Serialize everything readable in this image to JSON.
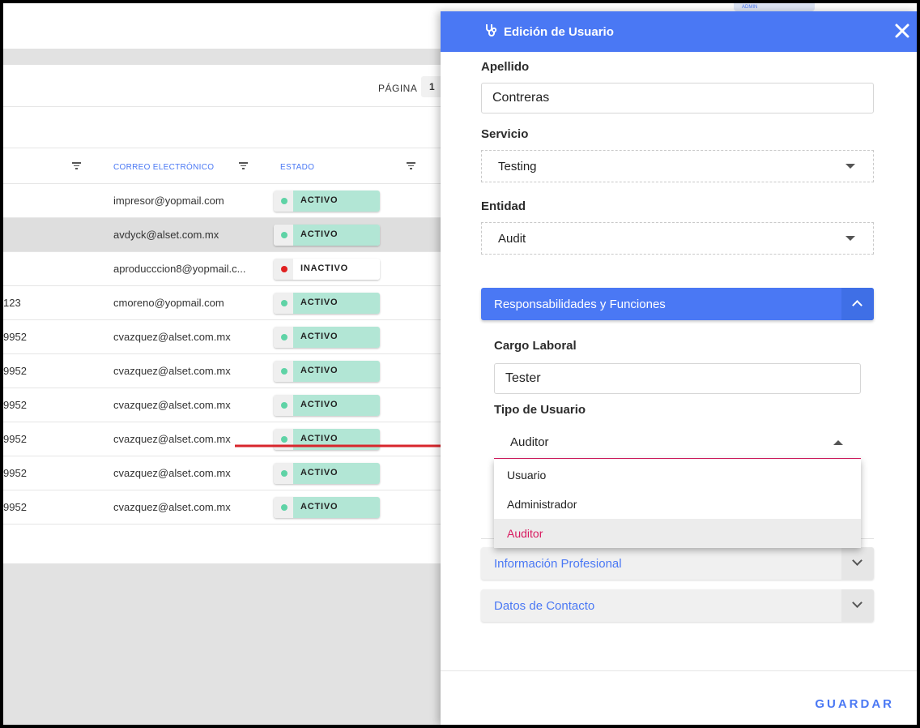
{
  "header": {
    "admin_badge": "ADMIN"
  },
  "pagination": {
    "label": "PÁGINA",
    "page": "1"
  },
  "table": {
    "columns": [
      "CORREO ELECTRÓNICO",
      "ESTADO"
    ],
    "rows": [
      {
        "id": "",
        "email": "impresor@yopmail.com",
        "status": "ACTIVO"
      },
      {
        "id": "",
        "email": "avdyck@alset.com.mx",
        "status": "ACTIVO"
      },
      {
        "id": "",
        "email": "aproducccion8@yopmail.c...",
        "status": "INACTIVO"
      },
      {
        "id": "123",
        "email": "cmoreno@yopmail.com",
        "status": "ACTIVO"
      },
      {
        "id": "9952",
        "email": "cvazquez@alset.com.mx",
        "status": "ACTIVO"
      },
      {
        "id": "9952",
        "email": "cvazquez@alset.com.mx",
        "status": "ACTIVO"
      },
      {
        "id": "9952",
        "email": "cvazquez@alset.com.mx",
        "status": "ACTIVO"
      },
      {
        "id": "9952",
        "email": "cvazquez@alset.com.mx",
        "status": "ACTIVO"
      },
      {
        "id": "9952",
        "email": "cvazquez@alset.com.mx",
        "status": "ACTIVO"
      },
      {
        "id": "9952",
        "email": "cvazquez@alset.com.mx",
        "status": "ACTIVO"
      }
    ],
    "highlighted_row": 1
  },
  "colors": {
    "accent": "#4a78f4",
    "active_bg": "#b2e6d5",
    "active_dot": "#5fd3a6",
    "inactive_dot": "#e02020",
    "selected": "#d81b60",
    "arrow": "#d8262c"
  },
  "drawer": {
    "title": "Edición de Usuario",
    "title_icon": "stethoscope-icon",
    "close_icon": "close-icon",
    "fields": {
      "apellido_label": "Apellido",
      "apellido_value": "Contreras",
      "servicio_label": "Servicio",
      "servicio_value": "Testing",
      "entidad_label": "Entidad",
      "entidad_value": "Audit"
    },
    "responsabilidades": {
      "title": "Responsabilidades y Funciones",
      "cargo_label": "Cargo Laboral",
      "cargo_value": "Tester",
      "tipo_label": "Tipo de Usuario",
      "tipo_value": "Auditor",
      "options": [
        "Usuario",
        "Administrador",
        "Auditor"
      ],
      "selected_option": 2
    },
    "info_profesional": "Información Profesional",
    "datos_contacto": "Datos de Contacto",
    "save_label": "GUARDAR"
  }
}
